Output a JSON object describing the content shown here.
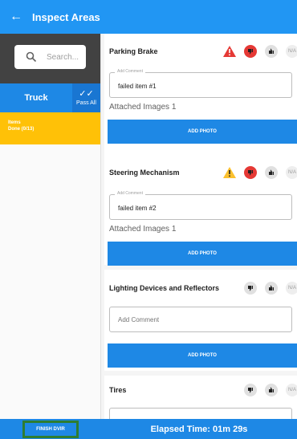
{
  "header": {
    "back_icon": "arrow-left-icon",
    "title": "Inspect Areas"
  },
  "sidebar": {
    "search_placeholder": "Search...",
    "truck_label": "Truck",
    "pass_all_label": "Pass All",
    "items_label": "Items",
    "items_done": "Done (0/13)"
  },
  "cards": [
    {
      "title": "Parking Brake",
      "warning_color": "#e53935",
      "comment_label": "Add Comment",
      "comment_value": "failed item #1",
      "attached": "Attached Images 1",
      "add_photo": "ADD PHOTO",
      "na": "N/A"
    },
    {
      "title": "Steering Mechanism",
      "warning_color": "#fbc02d",
      "comment_label": "Add Comment",
      "comment_value": "failed item #2",
      "attached": "Attached Images 1",
      "add_photo": "ADD PHOTO",
      "na": "N/A"
    },
    {
      "title": "Lighting Devices and Reflectors",
      "comment_placeholder": "Add Comment",
      "add_photo": "ADD PHOTO",
      "na": "N/A"
    },
    {
      "title": "Tires",
      "na": "N/A"
    }
  ],
  "footer": {
    "finish_label": "FINISH DVIR",
    "elapsed": "Elapsed Time:  01m 29s"
  },
  "colors": {
    "primary": "#1e88e5",
    "warning_yellow": "#ffc107",
    "fail_red": "#e53935",
    "finish_border": "#2e7d32"
  }
}
